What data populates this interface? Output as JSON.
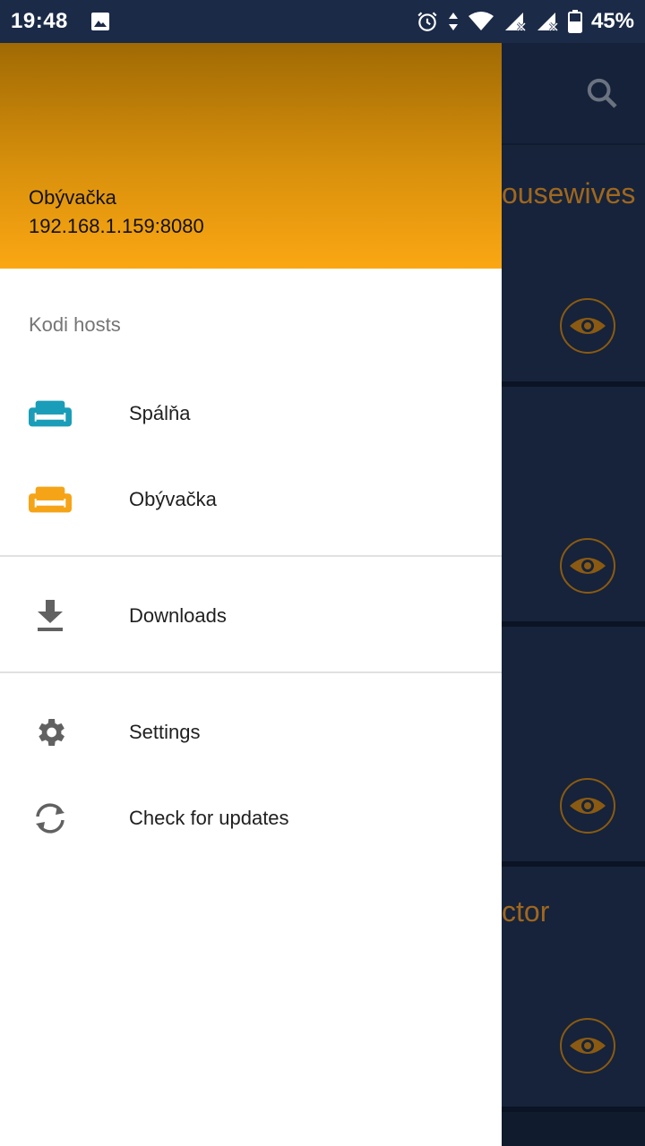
{
  "status_bar": {
    "time": "19:48",
    "battery": "45%"
  },
  "background": {
    "title_top": "ousewives",
    "title_bottom": "ctor"
  },
  "drawer": {
    "host": {
      "name": "Obývačka",
      "address": "192.168.1.159:8080"
    },
    "section_label": "Kodi hosts",
    "hosts": [
      {
        "label": "Spálňa",
        "color": "#1a9db8"
      },
      {
        "label": "Obývačka",
        "color": "#f6a417"
      }
    ],
    "downloads_label": "Downloads",
    "settings_label": "Settings",
    "updates_label": "Check for updates"
  },
  "colors": {
    "accent": "#f6a417",
    "header_top": "#a06a04",
    "header_bottom": "#fba713"
  }
}
